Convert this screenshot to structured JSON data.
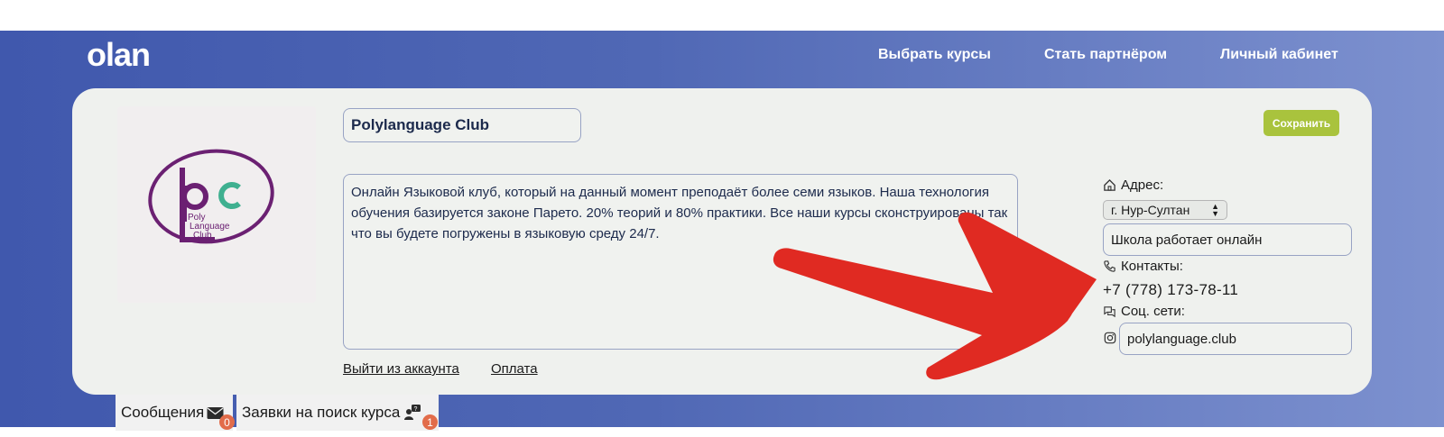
{
  "header": {
    "logo": "olan",
    "nav": [
      "Выбрать курсы",
      "Стать партнёром",
      "Личный кабинет"
    ]
  },
  "profile": {
    "school_logo_text": [
      "Poly",
      "Language",
      "Club"
    ],
    "name": "Polylanguage Club",
    "description": "Онлайн Языковой клуб, который на данный момент преподаёт более семи языков. Наша технология обучения базируется законе Парето. 20% теорий и 80% практики. Все наши курсы сконструированы так что вы будете погружены в языковую среду 24/7.",
    "save_label": "Сохранить",
    "logout_link": "Выйти из аккаунта",
    "payment_link": "Оплата"
  },
  "sidebar": {
    "address_label": "Адрес:",
    "city": "г. Нур-Султан",
    "address_value": "Школа работает онлайн",
    "contacts_label": "Контакты:",
    "phone": "+7 (778) 173-78-11",
    "social_label": "Соц. сети:",
    "instagram": "polylanguage.club"
  },
  "tabs": [
    {
      "label": "Сообщения",
      "count": "0"
    },
    {
      "label": "Заявки на поиск курса",
      "count": "1"
    }
  ],
  "colors": {
    "accent_green": "#a9c33d",
    "annotation_arrow": "#e02a22",
    "badge": "#e26c4a"
  }
}
